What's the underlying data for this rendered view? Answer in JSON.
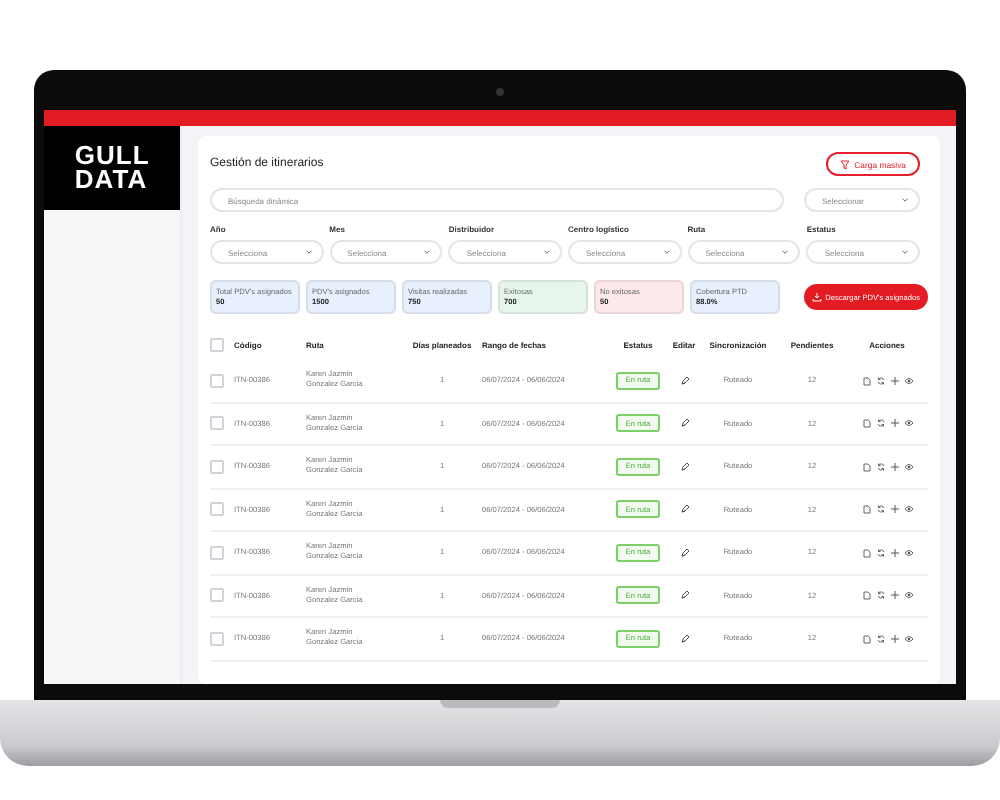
{
  "logo": "GULL DATA",
  "title": "Gestión de itinerarios",
  "bulk_button": "Carga masiva",
  "search": {
    "placeholder": "Búsqueda dinámica"
  },
  "search_select": {
    "placeholder": "Seleccionar"
  },
  "filters": [
    {
      "label": "Año",
      "placeholder": "Selecciona"
    },
    {
      "label": "Mes",
      "placeholder": "Selecciona"
    },
    {
      "label": "Distribuidor",
      "placeholder": "Selecciona"
    },
    {
      "label": "Centro logístico",
      "placeholder": "Selecciona"
    },
    {
      "label": "Ruta",
      "placeholder": "Selecciona"
    },
    {
      "label": "Estatus",
      "placeholder": "Selecciona"
    }
  ],
  "stats": [
    {
      "label": "Total PDV's asignados",
      "value": "50",
      "color": "#e8f0fd"
    },
    {
      "label": "PDV's asignados",
      "value": "1500",
      "color": "#e8f0fd"
    },
    {
      "label": "Visitas realizadas",
      "value": "750",
      "color": "#e8f0fd"
    },
    {
      "label": "Exitosas",
      "value": "700",
      "color": "#e6f6ec"
    },
    {
      "label": "No exitosas",
      "value": "50",
      "color": "#fde8ea"
    },
    {
      "label": "Cobertura PTD",
      "value": "88.0%",
      "color": "#e8f0fd"
    }
  ],
  "download_button": "Descargar PDV's asignados",
  "table": {
    "select_all_checked": false,
    "columns": [
      "Código",
      "Ruta",
      "Días planeados",
      "Rango de fechas",
      "Estatus",
      "Editar",
      "Sincronización",
      "Pendientes",
      "Acciones"
    ],
    "rows": [
      {
        "checked": false,
        "code": "ITN-00386",
        "route": "Karen Jazmin Gonzalez Garcia",
        "days": "1",
        "dates": "06/07/2024 - 06/06/2024",
        "status": "En ruta",
        "sync": "Ruteado",
        "pending": "12"
      },
      {
        "checked": false,
        "code": "ITN-00386",
        "route": "Karen Jazmin Gonzalez Garcia",
        "days": "1",
        "dates": "06/07/2024 - 06/06/2024",
        "status": "En ruta",
        "sync": "Ruteado",
        "pending": "12"
      },
      {
        "checked": false,
        "code": "ITN-00386",
        "route": "Karen Jazmin Gonzalez Garcia",
        "days": "1",
        "dates": "06/07/2024 - 06/06/2024",
        "status": "En ruta",
        "sync": "Ruteado",
        "pending": "12"
      },
      {
        "checked": false,
        "code": "ITN-00386",
        "route": "Karen Jazmin Gonzalez Garcia",
        "days": "1",
        "dates": "06/07/2024 - 06/06/2024",
        "status": "En ruta",
        "sync": "Ruteado",
        "pending": "12"
      },
      {
        "checked": false,
        "code": "ITN-00386",
        "route": "Karen Jazmin Gonzalez Garcia",
        "days": "1",
        "dates": "06/07/2024 - 06/06/2024",
        "status": "En ruta",
        "sync": "Ruteado",
        "pending": "12"
      },
      {
        "checked": false,
        "code": "ITN-00386",
        "route": "Karen Jazmin Gonzalez Garcia",
        "days": "1",
        "dates": "06/07/2024 - 06/06/2024",
        "status": "En ruta",
        "sync": "Ruteado",
        "pending": "12"
      },
      {
        "checked": false,
        "code": "ITN-00386",
        "route": "Karen Jazmin Gonzalez Garcia",
        "days": "1",
        "dates": "06/07/2024 - 06/06/2024",
        "status": "En ruta",
        "sync": "Ruteado",
        "pending": "12"
      }
    ]
  }
}
